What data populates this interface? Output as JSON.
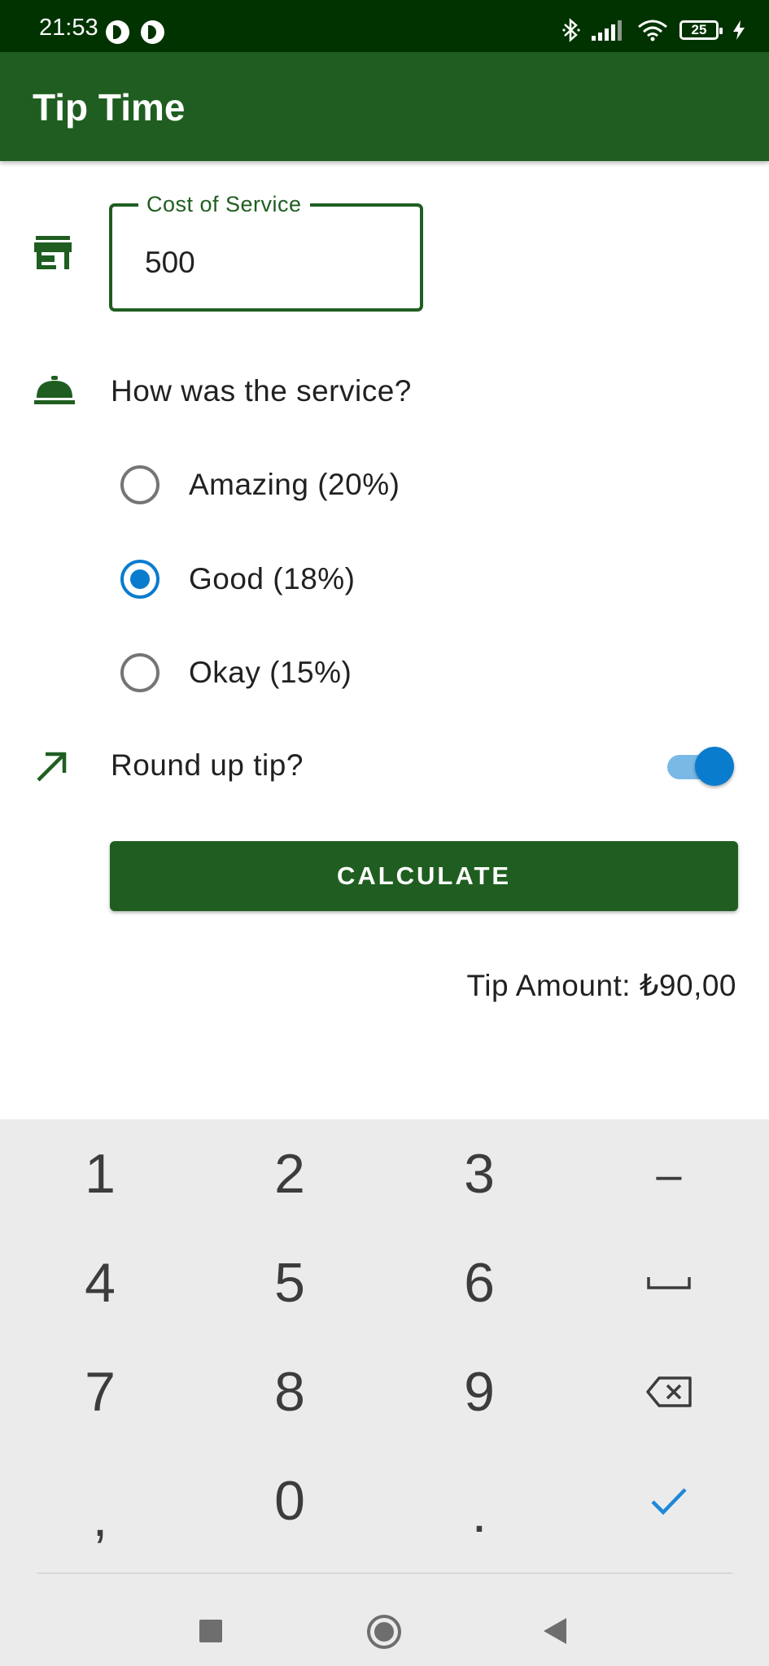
{
  "status_bar": {
    "time": "21:53",
    "battery_level": "25",
    "icons": [
      "app-notification-icon",
      "app-notification-icon",
      "bluetooth-icon",
      "signal-icon",
      "wifi-icon",
      "battery-icon",
      "charging-icon"
    ]
  },
  "app_bar": {
    "title": "Tip Time"
  },
  "form": {
    "cost_field": {
      "label": "Cost of Service",
      "value": "500",
      "icon": "store-icon"
    },
    "service_question": {
      "text": "How was the service?",
      "icon": "room-service-icon"
    },
    "options": [
      {
        "label": "Amazing (20%)",
        "selected": false
      },
      {
        "label": "Good (18%)",
        "selected": true
      },
      {
        "label": "Okay (15%)",
        "selected": false
      }
    ],
    "round_up": {
      "label": "Round up tip?",
      "enabled": true,
      "icon": "trending-up-arrow-icon"
    },
    "calculate_button": "CALCULATE",
    "tip_amount": "Tip Amount: ₺90,00"
  },
  "colors": {
    "primary": "#1f5e20",
    "status_bar": "#003300",
    "accent": "#0a7cce",
    "keyboard_bg": "#ebebeb"
  },
  "keyboard": {
    "keys": {
      "k1": "1",
      "k2": "2",
      "k3": "3",
      "minus": "–",
      "k4": "4",
      "k5": "5",
      "k6": "6",
      "k7": "7",
      "k8": "8",
      "k9": "9",
      "comma": ",",
      "k0": "0",
      "period": "."
    },
    "icons": [
      "space-key-icon",
      "backspace-icon",
      "done-check-icon"
    ]
  },
  "nav_bar": {
    "icons": [
      "recents-square-icon",
      "home-circle-icon",
      "back-triangle-icon"
    ]
  }
}
